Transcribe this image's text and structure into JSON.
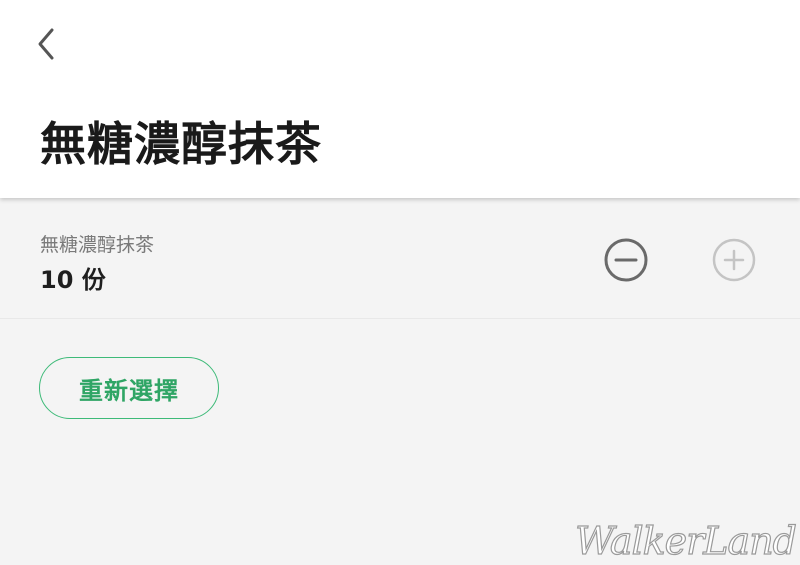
{
  "header": {
    "back_icon": "chevron-left-icon",
    "title": "無糖濃醇抹茶"
  },
  "item": {
    "name": "無糖濃醇抹茶",
    "quantity": "10 份",
    "minus_icon": "minus-circle-icon",
    "plus_icon": "plus-circle-icon"
  },
  "actions": {
    "reselect_label": "重新選擇"
  },
  "watermark": {
    "text": "WalkerLand"
  },
  "colors": {
    "accent_green": "#3dba78",
    "accent_green_text": "#2fa565",
    "background": "#f4f4f4",
    "header_background": "#ffffff",
    "minus_active": "#6a6a6a",
    "plus_disabled": "#c4c4c4"
  }
}
